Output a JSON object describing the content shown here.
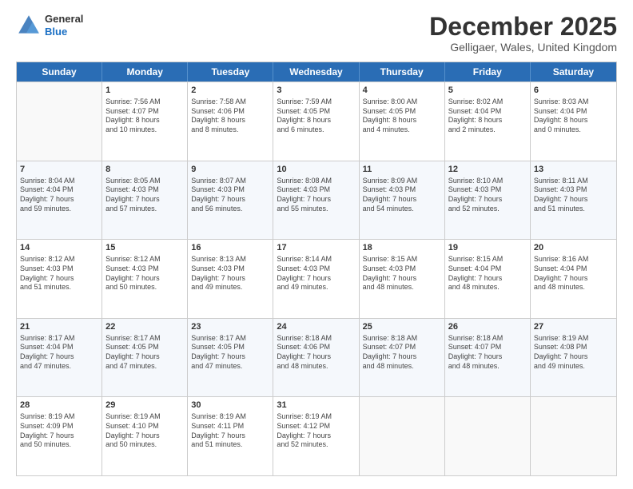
{
  "header": {
    "logo_line1": "General",
    "logo_line2": "Blue",
    "month_title": "December 2025",
    "location": "Gelligaer, Wales, United Kingdom"
  },
  "weekdays": [
    "Sunday",
    "Monday",
    "Tuesday",
    "Wednesday",
    "Thursday",
    "Friday",
    "Saturday"
  ],
  "rows": [
    [
      {
        "day": "",
        "info": ""
      },
      {
        "day": "1",
        "info": "Sunrise: 7:56 AM\nSunset: 4:07 PM\nDaylight: 8 hours\nand 10 minutes."
      },
      {
        "day": "2",
        "info": "Sunrise: 7:58 AM\nSunset: 4:06 PM\nDaylight: 8 hours\nand 8 minutes."
      },
      {
        "day": "3",
        "info": "Sunrise: 7:59 AM\nSunset: 4:05 PM\nDaylight: 8 hours\nand 6 minutes."
      },
      {
        "day": "4",
        "info": "Sunrise: 8:00 AM\nSunset: 4:05 PM\nDaylight: 8 hours\nand 4 minutes."
      },
      {
        "day": "5",
        "info": "Sunrise: 8:02 AM\nSunset: 4:04 PM\nDaylight: 8 hours\nand 2 minutes."
      },
      {
        "day": "6",
        "info": "Sunrise: 8:03 AM\nSunset: 4:04 PM\nDaylight: 8 hours\nand 0 minutes."
      }
    ],
    [
      {
        "day": "7",
        "info": "Sunrise: 8:04 AM\nSunset: 4:04 PM\nDaylight: 7 hours\nand 59 minutes."
      },
      {
        "day": "8",
        "info": "Sunrise: 8:05 AM\nSunset: 4:03 PM\nDaylight: 7 hours\nand 57 minutes."
      },
      {
        "day": "9",
        "info": "Sunrise: 8:07 AM\nSunset: 4:03 PM\nDaylight: 7 hours\nand 56 minutes."
      },
      {
        "day": "10",
        "info": "Sunrise: 8:08 AM\nSunset: 4:03 PM\nDaylight: 7 hours\nand 55 minutes."
      },
      {
        "day": "11",
        "info": "Sunrise: 8:09 AM\nSunset: 4:03 PM\nDaylight: 7 hours\nand 54 minutes."
      },
      {
        "day": "12",
        "info": "Sunrise: 8:10 AM\nSunset: 4:03 PM\nDaylight: 7 hours\nand 52 minutes."
      },
      {
        "day": "13",
        "info": "Sunrise: 8:11 AM\nSunset: 4:03 PM\nDaylight: 7 hours\nand 51 minutes."
      }
    ],
    [
      {
        "day": "14",
        "info": "Sunrise: 8:12 AM\nSunset: 4:03 PM\nDaylight: 7 hours\nand 51 minutes."
      },
      {
        "day": "15",
        "info": "Sunrise: 8:12 AM\nSunset: 4:03 PM\nDaylight: 7 hours\nand 50 minutes."
      },
      {
        "day": "16",
        "info": "Sunrise: 8:13 AM\nSunset: 4:03 PM\nDaylight: 7 hours\nand 49 minutes."
      },
      {
        "day": "17",
        "info": "Sunrise: 8:14 AM\nSunset: 4:03 PM\nDaylight: 7 hours\nand 49 minutes."
      },
      {
        "day": "18",
        "info": "Sunrise: 8:15 AM\nSunset: 4:03 PM\nDaylight: 7 hours\nand 48 minutes."
      },
      {
        "day": "19",
        "info": "Sunrise: 8:15 AM\nSunset: 4:04 PM\nDaylight: 7 hours\nand 48 minutes."
      },
      {
        "day": "20",
        "info": "Sunrise: 8:16 AM\nSunset: 4:04 PM\nDaylight: 7 hours\nand 48 minutes."
      }
    ],
    [
      {
        "day": "21",
        "info": "Sunrise: 8:17 AM\nSunset: 4:04 PM\nDaylight: 7 hours\nand 47 minutes."
      },
      {
        "day": "22",
        "info": "Sunrise: 8:17 AM\nSunset: 4:05 PM\nDaylight: 7 hours\nand 47 minutes."
      },
      {
        "day": "23",
        "info": "Sunrise: 8:17 AM\nSunset: 4:05 PM\nDaylight: 7 hours\nand 47 minutes."
      },
      {
        "day": "24",
        "info": "Sunrise: 8:18 AM\nSunset: 4:06 PM\nDaylight: 7 hours\nand 48 minutes."
      },
      {
        "day": "25",
        "info": "Sunrise: 8:18 AM\nSunset: 4:07 PM\nDaylight: 7 hours\nand 48 minutes."
      },
      {
        "day": "26",
        "info": "Sunrise: 8:18 AM\nSunset: 4:07 PM\nDaylight: 7 hours\nand 48 minutes."
      },
      {
        "day": "27",
        "info": "Sunrise: 8:19 AM\nSunset: 4:08 PM\nDaylight: 7 hours\nand 49 minutes."
      }
    ],
    [
      {
        "day": "28",
        "info": "Sunrise: 8:19 AM\nSunset: 4:09 PM\nDaylight: 7 hours\nand 50 minutes."
      },
      {
        "day": "29",
        "info": "Sunrise: 8:19 AM\nSunset: 4:10 PM\nDaylight: 7 hours\nand 50 minutes."
      },
      {
        "day": "30",
        "info": "Sunrise: 8:19 AM\nSunset: 4:11 PM\nDaylight: 7 hours\nand 51 minutes."
      },
      {
        "day": "31",
        "info": "Sunrise: 8:19 AM\nSunset: 4:12 PM\nDaylight: 7 hours\nand 52 minutes."
      },
      {
        "day": "",
        "info": ""
      },
      {
        "day": "",
        "info": ""
      },
      {
        "day": "",
        "info": ""
      }
    ]
  ]
}
